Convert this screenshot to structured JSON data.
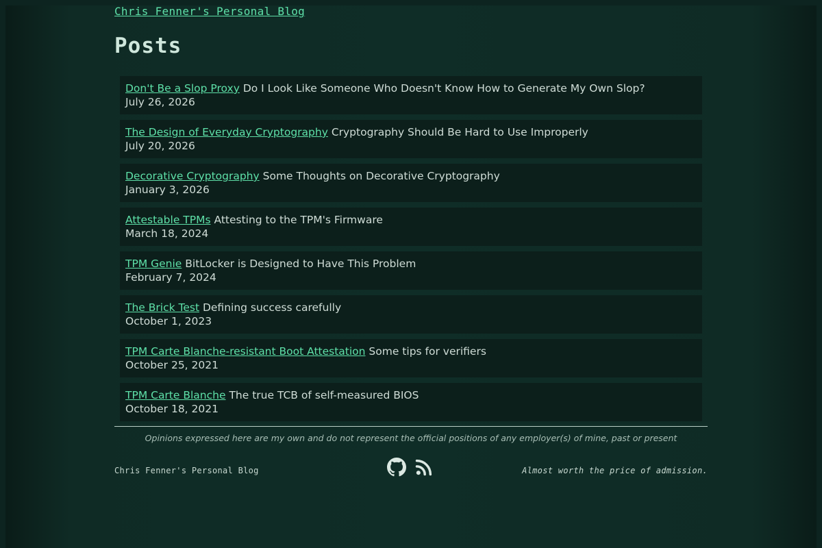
{
  "header": {
    "site_title": "Chris Fenner's Personal Blog",
    "page_title": "Posts"
  },
  "posts": [
    {
      "title": "Don't Be a Slop Proxy",
      "subtitle": "Do I Look Like Someone Who Doesn't Know How to Generate My Own Slop?",
      "date": "July 26, 2026"
    },
    {
      "title": "The Design of Everyday Cryptography",
      "subtitle": "Cryptography Should Be Hard to Use Improperly",
      "date": "July 20, 2026"
    },
    {
      "title": "Decorative Cryptography",
      "subtitle": "Some Thoughts on Decorative Cryptography",
      "date": "January 3, 2026"
    },
    {
      "title": "Attestable TPMs",
      "subtitle": "Attesting to the TPM's Firmware",
      "date": "March 18, 2024"
    },
    {
      "title": "TPM Genie",
      "subtitle": "BitLocker is Designed to Have This Problem",
      "date": "February 7, 2024"
    },
    {
      "title": "The Brick Test",
      "subtitle": "Defining success carefully",
      "date": "October 1, 2023"
    },
    {
      "title": "TPM Carte Blanche-resistant Boot Attestation",
      "subtitle": "Some tips for verifiers",
      "date": "October 25, 2021"
    },
    {
      "title": "TPM Carte Blanche",
      "subtitle": "The true TCB of self-measured BIOS",
      "date": "October 18, 2021"
    }
  ],
  "footer": {
    "disclaimer": "Opinions expressed here are my own and do not represent the official positions of any employer(s) of mine, past or present",
    "left_text": "Chris Fenner's Personal Blog",
    "right_text": "Almost worth the price of admission.",
    "icons": [
      "github-icon",
      "rss-icon"
    ]
  },
  "colors": {
    "background": "#0f2d27",
    "card": "#0c1f1b",
    "link": "#5ee0a8",
    "text": "#cfdcd6"
  }
}
